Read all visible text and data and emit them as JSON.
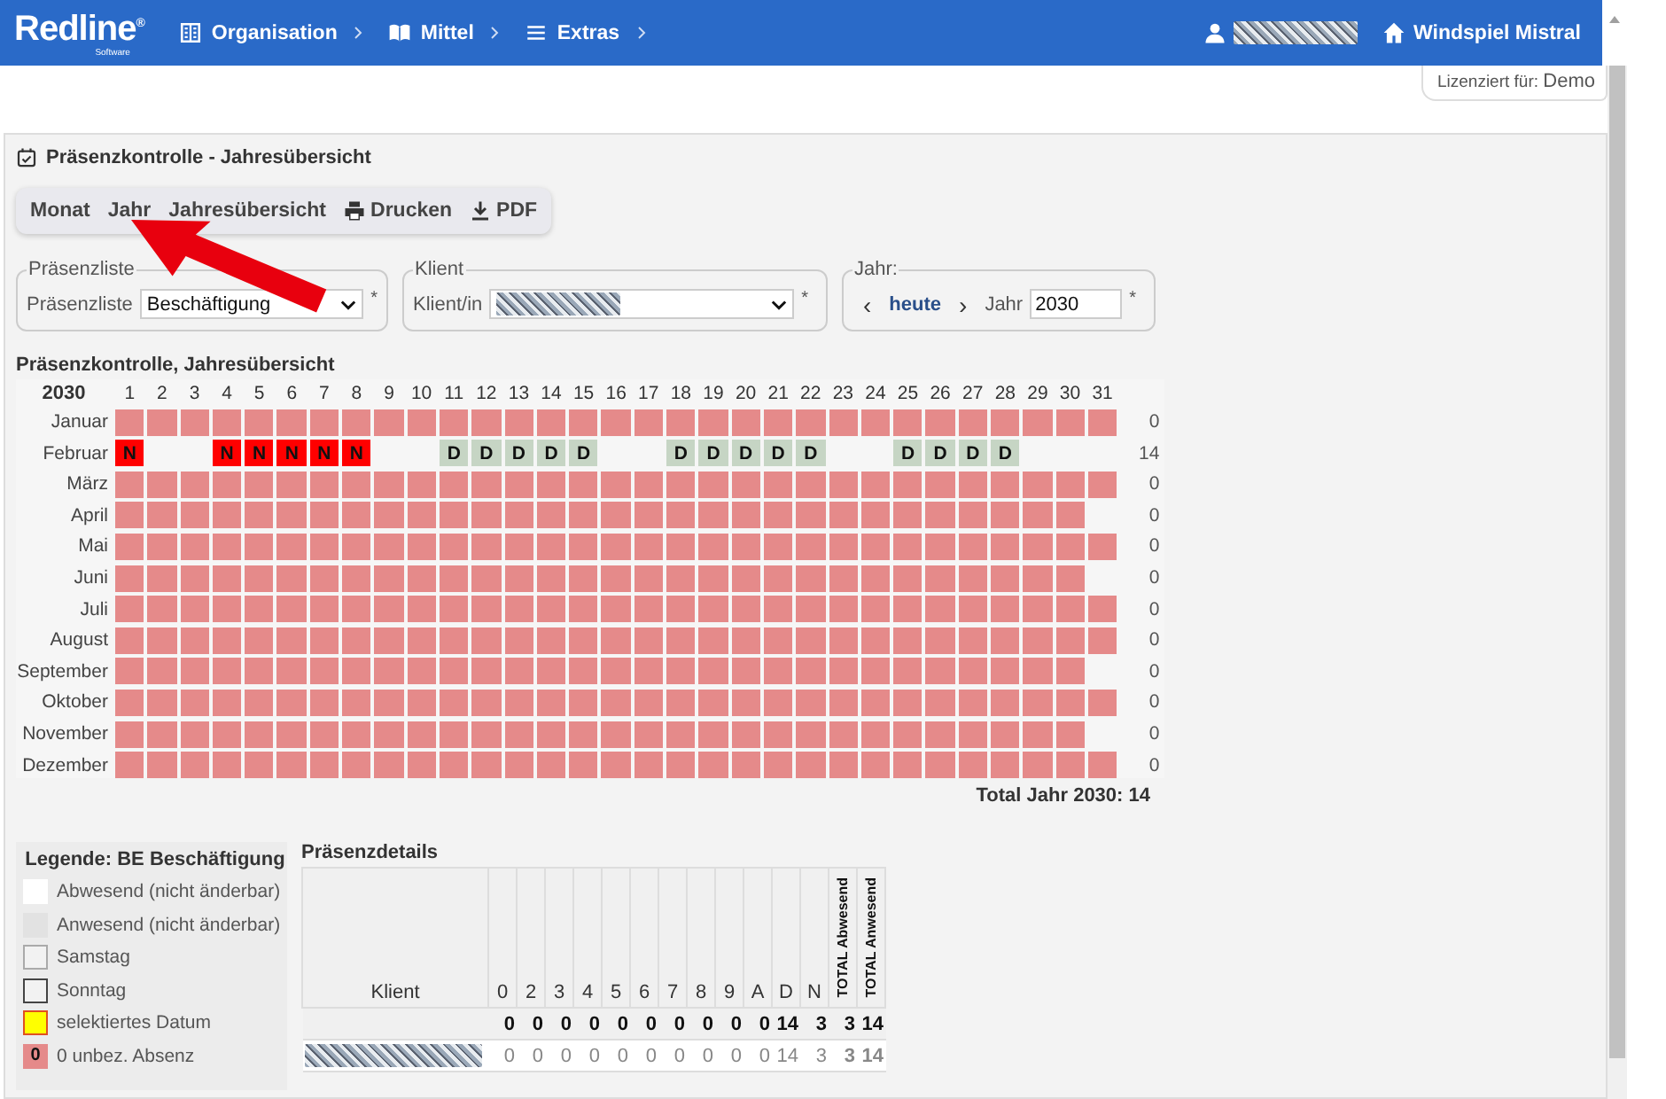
{
  "header": {
    "logo": "Redline$^{®}$",
    "logo_sub": "Software",
    "nav": [
      {
        "label": "Organisation"
      },
      {
        "label": "Mittel"
      },
      {
        "label": "Extras"
      }
    ],
    "place": "Windspiel Mistral"
  },
  "license": {
    "label": "Lizenziert für:",
    "value": "Demo"
  },
  "panel": {
    "title": "Präsenzkontrolle - Jahresübersicht",
    "toolbar": [
      {
        "label": "Monat"
      },
      {
        "label": "Jahr"
      },
      {
        "label": "Jahresübersicht"
      },
      {
        "label": "Drucken"
      },
      {
        "label": "PDF"
      }
    ],
    "filters": {
      "list": {
        "legend": "Präsenzliste",
        "label": "Präsenzliste",
        "value": "Beschäftigung",
        "required": "*"
      },
      "client": {
        "legend": "Klient",
        "label": "Klient/in",
        "required": "*"
      },
      "year": {
        "legend": "Jahr:",
        "prev": "‹",
        "today": "heute",
        "next": "›",
        "label": "Jahr",
        "value": "2030",
        "required": "*"
      }
    }
  },
  "overview": {
    "title": "Präsenzkontrolle, Jahresübersicht",
    "year": "2030",
    "days": [
      "1",
      "2",
      "3",
      "4",
      "5",
      "6",
      "7",
      "8",
      "9",
      "10",
      "11",
      "12",
      "13",
      "14",
      "15",
      "16",
      "17",
      "18",
      "19",
      "20",
      "21",
      "22",
      "23",
      "24",
      "25",
      "26",
      "27",
      "28",
      "29",
      "30",
      "31"
    ],
    "months": [
      {
        "name": "Januar",
        "total": "0",
        "cells": [
          {
            "kind": "open"
          },
          {
            "kind": "open"
          },
          {
            "kind": "open"
          },
          {
            "kind": "open"
          },
          {
            "kind": "open"
          },
          {
            "kind": "open"
          },
          {
            "kind": "open"
          },
          {
            "kind": "open"
          },
          {
            "kind": "open"
          },
          {
            "kind": "open"
          },
          {
            "kind": "open"
          },
          {
            "kind": "open"
          },
          {
            "kind": "open"
          },
          {
            "kind": "open"
          },
          {
            "kind": "open"
          },
          {
            "kind": "open"
          },
          {
            "kind": "open"
          },
          {
            "kind": "open"
          },
          {
            "kind": "open"
          },
          {
            "kind": "open"
          },
          {
            "kind": "open"
          },
          {
            "kind": "open"
          },
          {
            "kind": "open"
          },
          {
            "kind": "open"
          },
          {
            "kind": "open"
          },
          {
            "kind": "open"
          },
          {
            "kind": "open"
          },
          {
            "kind": "open"
          },
          {
            "kind": "open"
          },
          {
            "kind": "open"
          },
          {
            "kind": "open"
          }
        ]
      },
      {
        "name": "Februar",
        "total": "14",
        "cells": [
          {
            "kind": "code",
            "code": "N",
            "color": "#ff0000"
          },
          {
            "kind": "weekend"
          },
          {
            "kind": "weekend"
          },
          {
            "kind": "code",
            "code": "N",
            "color": "#ff0000"
          },
          {
            "kind": "code",
            "code": "N",
            "color": "#ff0000"
          },
          {
            "kind": "code",
            "code": "N",
            "color": "#ff0000"
          },
          {
            "kind": "code",
            "code": "N",
            "color": "#ff0000"
          },
          {
            "kind": "code",
            "code": "N",
            "color": "#ff0000"
          },
          {
            "kind": "weekend"
          },
          {
            "kind": "weekend"
          },
          {
            "kind": "code",
            "code": "D",
            "color": "#c6d5c4"
          },
          {
            "kind": "code",
            "code": "D",
            "color": "#c6d5c4"
          },
          {
            "kind": "code",
            "code": "D",
            "color": "#c6d5c4"
          },
          {
            "kind": "code",
            "code": "D",
            "color": "#c6d5c4"
          },
          {
            "kind": "code",
            "code": "D",
            "color": "#c6d5c4"
          },
          {
            "kind": "weekend"
          },
          {
            "kind": "weekend"
          },
          {
            "kind": "code",
            "code": "D",
            "color": "#c6d5c4"
          },
          {
            "kind": "code",
            "code": "D",
            "color": "#c6d5c4"
          },
          {
            "kind": "code",
            "code": "D",
            "color": "#c6d5c4"
          },
          {
            "kind": "code",
            "code": "D",
            "color": "#c6d5c4"
          },
          {
            "kind": "code",
            "code": "D",
            "color": "#c6d5c4"
          },
          {
            "kind": "weekend"
          },
          {
            "kind": "weekend"
          },
          {
            "kind": "code",
            "code": "D",
            "color": "#c6d5c4"
          },
          {
            "kind": "code",
            "code": "D",
            "color": "#c6d5c4"
          },
          {
            "kind": "code",
            "code": "D",
            "color": "#c6d5c4"
          },
          {
            "kind": "code",
            "code": "D",
            "color": "#c6d5c4"
          },
          {
            "kind": "none"
          },
          {
            "kind": "none"
          },
          {
            "kind": "none"
          }
        ]
      },
      {
        "name": "März",
        "total": "0",
        "cells": [
          {
            "kind": "open"
          },
          {
            "kind": "open"
          },
          {
            "kind": "open"
          },
          {
            "kind": "open"
          },
          {
            "kind": "open"
          },
          {
            "kind": "open"
          },
          {
            "kind": "open"
          },
          {
            "kind": "open"
          },
          {
            "kind": "open"
          },
          {
            "kind": "open"
          },
          {
            "kind": "open"
          },
          {
            "kind": "open"
          },
          {
            "kind": "open"
          },
          {
            "kind": "open"
          },
          {
            "kind": "open"
          },
          {
            "kind": "open"
          },
          {
            "kind": "open"
          },
          {
            "kind": "open"
          },
          {
            "kind": "open"
          },
          {
            "kind": "open"
          },
          {
            "kind": "open"
          },
          {
            "kind": "open"
          },
          {
            "kind": "open"
          },
          {
            "kind": "open"
          },
          {
            "kind": "open"
          },
          {
            "kind": "open"
          },
          {
            "kind": "open"
          },
          {
            "kind": "open"
          },
          {
            "kind": "open"
          },
          {
            "kind": "open"
          },
          {
            "kind": "open"
          }
        ]
      },
      {
        "name": "April",
        "total": "0",
        "cells": [
          {
            "kind": "open"
          },
          {
            "kind": "open"
          },
          {
            "kind": "open"
          },
          {
            "kind": "open"
          },
          {
            "kind": "open"
          },
          {
            "kind": "open"
          },
          {
            "kind": "open"
          },
          {
            "kind": "open"
          },
          {
            "kind": "open"
          },
          {
            "kind": "open"
          },
          {
            "kind": "open"
          },
          {
            "kind": "open"
          },
          {
            "kind": "open"
          },
          {
            "kind": "open"
          },
          {
            "kind": "open"
          },
          {
            "kind": "open"
          },
          {
            "kind": "open"
          },
          {
            "kind": "open"
          },
          {
            "kind": "open"
          },
          {
            "kind": "open"
          },
          {
            "kind": "open"
          },
          {
            "kind": "open"
          },
          {
            "kind": "open"
          },
          {
            "kind": "open"
          },
          {
            "kind": "open"
          },
          {
            "kind": "open"
          },
          {
            "kind": "open"
          },
          {
            "kind": "open"
          },
          {
            "kind": "open"
          },
          {
            "kind": "open"
          },
          {
            "kind": "none"
          }
        ]
      },
      {
        "name": "Mai",
        "total": "0",
        "cells": [
          {
            "kind": "open"
          },
          {
            "kind": "open"
          },
          {
            "kind": "open"
          },
          {
            "kind": "open"
          },
          {
            "kind": "open"
          },
          {
            "kind": "open"
          },
          {
            "kind": "open"
          },
          {
            "kind": "open"
          },
          {
            "kind": "open"
          },
          {
            "kind": "open"
          },
          {
            "kind": "open"
          },
          {
            "kind": "open"
          },
          {
            "kind": "open"
          },
          {
            "kind": "open"
          },
          {
            "kind": "open"
          },
          {
            "kind": "open"
          },
          {
            "kind": "open"
          },
          {
            "kind": "open"
          },
          {
            "kind": "open"
          },
          {
            "kind": "open"
          },
          {
            "kind": "open"
          },
          {
            "kind": "open"
          },
          {
            "kind": "open"
          },
          {
            "kind": "open"
          },
          {
            "kind": "open"
          },
          {
            "kind": "open"
          },
          {
            "kind": "open"
          },
          {
            "kind": "open"
          },
          {
            "kind": "open"
          },
          {
            "kind": "open"
          },
          {
            "kind": "open"
          }
        ]
      },
      {
        "name": "Juni",
        "total": "0",
        "cells": [
          {
            "kind": "open"
          },
          {
            "kind": "open"
          },
          {
            "kind": "open"
          },
          {
            "kind": "open"
          },
          {
            "kind": "open"
          },
          {
            "kind": "open"
          },
          {
            "kind": "open"
          },
          {
            "kind": "open"
          },
          {
            "kind": "open"
          },
          {
            "kind": "open"
          },
          {
            "kind": "open"
          },
          {
            "kind": "open"
          },
          {
            "kind": "open"
          },
          {
            "kind": "open"
          },
          {
            "kind": "open"
          },
          {
            "kind": "open"
          },
          {
            "kind": "open"
          },
          {
            "kind": "open"
          },
          {
            "kind": "open"
          },
          {
            "kind": "open"
          },
          {
            "kind": "open"
          },
          {
            "kind": "open"
          },
          {
            "kind": "open"
          },
          {
            "kind": "open"
          },
          {
            "kind": "open"
          },
          {
            "kind": "open"
          },
          {
            "kind": "open"
          },
          {
            "kind": "open"
          },
          {
            "kind": "open"
          },
          {
            "kind": "open"
          },
          {
            "kind": "none"
          }
        ]
      },
      {
        "name": "Juli",
        "total": "0",
        "cells": [
          {
            "kind": "open"
          },
          {
            "kind": "open"
          },
          {
            "kind": "open"
          },
          {
            "kind": "open"
          },
          {
            "kind": "open"
          },
          {
            "kind": "open"
          },
          {
            "kind": "open"
          },
          {
            "kind": "open"
          },
          {
            "kind": "open"
          },
          {
            "kind": "open"
          },
          {
            "kind": "open"
          },
          {
            "kind": "open"
          },
          {
            "kind": "open"
          },
          {
            "kind": "open"
          },
          {
            "kind": "open"
          },
          {
            "kind": "open"
          },
          {
            "kind": "open"
          },
          {
            "kind": "open"
          },
          {
            "kind": "open"
          },
          {
            "kind": "open"
          },
          {
            "kind": "open"
          },
          {
            "kind": "open"
          },
          {
            "kind": "open"
          },
          {
            "kind": "open"
          },
          {
            "kind": "open"
          },
          {
            "kind": "open"
          },
          {
            "kind": "open"
          },
          {
            "kind": "open"
          },
          {
            "kind": "open"
          },
          {
            "kind": "open"
          },
          {
            "kind": "open"
          }
        ]
      },
      {
        "name": "August",
        "total": "0",
        "cells": [
          {
            "kind": "open"
          },
          {
            "kind": "open"
          },
          {
            "kind": "open"
          },
          {
            "kind": "open"
          },
          {
            "kind": "open"
          },
          {
            "kind": "open"
          },
          {
            "kind": "open"
          },
          {
            "kind": "open"
          },
          {
            "kind": "open"
          },
          {
            "kind": "open"
          },
          {
            "kind": "open"
          },
          {
            "kind": "open"
          },
          {
            "kind": "open"
          },
          {
            "kind": "open"
          },
          {
            "kind": "open"
          },
          {
            "kind": "open"
          },
          {
            "kind": "open"
          },
          {
            "kind": "open"
          },
          {
            "kind": "open"
          },
          {
            "kind": "open"
          },
          {
            "kind": "open"
          },
          {
            "kind": "open"
          },
          {
            "kind": "open"
          },
          {
            "kind": "open"
          },
          {
            "kind": "open"
          },
          {
            "kind": "open"
          },
          {
            "kind": "open"
          },
          {
            "kind": "open"
          },
          {
            "kind": "open"
          },
          {
            "kind": "open"
          },
          {
            "kind": "open"
          }
        ]
      },
      {
        "name": "September",
        "total": "0",
        "cells": [
          {
            "kind": "open"
          },
          {
            "kind": "open"
          },
          {
            "kind": "open"
          },
          {
            "kind": "open"
          },
          {
            "kind": "open"
          },
          {
            "kind": "open"
          },
          {
            "kind": "open"
          },
          {
            "kind": "open"
          },
          {
            "kind": "open"
          },
          {
            "kind": "open"
          },
          {
            "kind": "open"
          },
          {
            "kind": "open"
          },
          {
            "kind": "open"
          },
          {
            "kind": "open"
          },
          {
            "kind": "open"
          },
          {
            "kind": "open"
          },
          {
            "kind": "open"
          },
          {
            "kind": "open"
          },
          {
            "kind": "open"
          },
          {
            "kind": "open"
          },
          {
            "kind": "open"
          },
          {
            "kind": "open"
          },
          {
            "kind": "open"
          },
          {
            "kind": "open"
          },
          {
            "kind": "open"
          },
          {
            "kind": "open"
          },
          {
            "kind": "open"
          },
          {
            "kind": "open"
          },
          {
            "kind": "open"
          },
          {
            "kind": "open"
          },
          {
            "kind": "none"
          }
        ]
      },
      {
        "name": "Oktober",
        "total": "0",
        "cells": [
          {
            "kind": "open"
          },
          {
            "kind": "open"
          },
          {
            "kind": "open"
          },
          {
            "kind": "open"
          },
          {
            "kind": "open"
          },
          {
            "kind": "open"
          },
          {
            "kind": "open"
          },
          {
            "kind": "open"
          },
          {
            "kind": "open"
          },
          {
            "kind": "open"
          },
          {
            "kind": "open"
          },
          {
            "kind": "open"
          },
          {
            "kind": "open"
          },
          {
            "kind": "open"
          },
          {
            "kind": "open"
          },
          {
            "kind": "open"
          },
          {
            "kind": "open"
          },
          {
            "kind": "open"
          },
          {
            "kind": "open"
          },
          {
            "kind": "open"
          },
          {
            "kind": "open"
          },
          {
            "kind": "open"
          },
          {
            "kind": "open"
          },
          {
            "kind": "open"
          },
          {
            "kind": "open"
          },
          {
            "kind": "open"
          },
          {
            "kind": "open"
          },
          {
            "kind": "open"
          },
          {
            "kind": "open"
          },
          {
            "kind": "open"
          },
          {
            "kind": "open"
          }
        ]
      },
      {
        "name": "November",
        "total": "0",
        "cells": [
          {
            "kind": "open"
          },
          {
            "kind": "open"
          },
          {
            "kind": "open"
          },
          {
            "kind": "open"
          },
          {
            "kind": "open"
          },
          {
            "kind": "open"
          },
          {
            "kind": "open"
          },
          {
            "kind": "open"
          },
          {
            "kind": "open"
          },
          {
            "kind": "open"
          },
          {
            "kind": "open"
          },
          {
            "kind": "open"
          },
          {
            "kind": "open"
          },
          {
            "kind": "open"
          },
          {
            "kind": "open"
          },
          {
            "kind": "open"
          },
          {
            "kind": "open"
          },
          {
            "kind": "open"
          },
          {
            "kind": "open"
          },
          {
            "kind": "open"
          },
          {
            "kind": "open"
          },
          {
            "kind": "open"
          },
          {
            "kind": "open"
          },
          {
            "kind": "open"
          },
          {
            "kind": "open"
          },
          {
            "kind": "open"
          },
          {
            "kind": "open"
          },
          {
            "kind": "open"
          },
          {
            "kind": "open"
          },
          {
            "kind": "open"
          },
          {
            "kind": "none"
          }
        ]
      },
      {
        "name": "Dezember",
        "total": "0",
        "cells": [
          {
            "kind": "open"
          },
          {
            "kind": "open"
          },
          {
            "kind": "open"
          },
          {
            "kind": "open"
          },
          {
            "kind": "open"
          },
          {
            "kind": "open"
          },
          {
            "kind": "open"
          },
          {
            "kind": "open"
          },
          {
            "kind": "open"
          },
          {
            "kind": "open"
          },
          {
            "kind": "open"
          },
          {
            "kind": "open"
          },
          {
            "kind": "open"
          },
          {
            "kind": "open"
          },
          {
            "kind": "open"
          },
          {
            "kind": "open"
          },
          {
            "kind": "open"
          },
          {
            "kind": "open"
          },
          {
            "kind": "open"
          },
          {
            "kind": "open"
          },
          {
            "kind": "open"
          },
          {
            "kind": "open"
          },
          {
            "kind": "open"
          },
          {
            "kind": "open"
          },
          {
            "kind": "open"
          },
          {
            "kind": "open"
          },
          {
            "kind": "open"
          },
          {
            "kind": "open"
          },
          {
            "kind": "open"
          },
          {
            "kind": "open"
          },
          {
            "kind": "open"
          }
        ]
      }
    ],
    "grand_total": "Total Jahr 2030: 14"
  },
  "legend": {
    "title": "Legende: BE Beschäftigung",
    "items": [
      {
        "kind": "plain",
        "color": "#ffffff",
        "label": "Abwesend (nicht änderbar)"
      },
      {
        "kind": "plain",
        "color": "#e2e2e2",
        "label": "Anwesend (nicht änderbar)"
      },
      {
        "kind": "saturday",
        "color": "#f2f2f2",
        "label": "Samstag"
      },
      {
        "kind": "sunday",
        "color": "#f2f2f2",
        "label": "Sonntag"
      },
      {
        "kind": "selected",
        "color": "#ffff00",
        "label": "selektiertes Datum"
      },
      {
        "kind": "code",
        "color": "#e58a8a",
        "code": "0",
        "label": "0 unbez. Absenz"
      }
    ]
  },
  "details": {
    "title": "Präsenzdetails",
    "columns": [
      {
        "label": "Klient",
        "kind": "plain"
      },
      {
        "label": "0",
        "kind": "plain"
      },
      {
        "label": "2",
        "kind": "plain"
      },
      {
        "label": "3",
        "kind": "plain"
      },
      {
        "label": "4",
        "kind": "plain"
      },
      {
        "label": "5",
        "kind": "plain"
      },
      {
        "label": "6",
        "kind": "plain"
      },
      {
        "label": "7",
        "kind": "plain"
      },
      {
        "label": "8",
        "kind": "plain"
      },
      {
        "label": "9",
        "kind": "plain"
      },
      {
        "label": "A",
        "kind": "plain"
      },
      {
        "label": "D",
        "kind": "plain"
      },
      {
        "label": "N",
        "kind": "plain"
      },
      {
        "label": "TOTAL Abwesend",
        "kind": "vertical"
      },
      {
        "label": "TOTAL Anwesend",
        "kind": "vertical"
      }
    ],
    "rows": [
      {
        "kind": "total",
        "cells": [
          "",
          "0",
          "0",
          "0",
          "0",
          "0",
          "0",
          "0",
          "0",
          "0",
          "0",
          "14",
          "3",
          "3",
          "14"
        ]
      },
      {
        "kind": "client",
        "cells": [
          "",
          "0",
          "0",
          "0",
          "0",
          "0",
          "0",
          "0",
          "0",
          "0",
          "0",
          "14",
          "3",
          "3",
          "14"
        ]
      }
    ]
  }
}
